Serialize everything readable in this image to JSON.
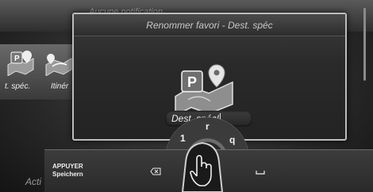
{
  "background": {
    "notification_text": "Aucune notification",
    "favorites": [
      {
        "label": "t. spéc.",
        "icon": "parking-map-icon"
      },
      {
        "label": "Itinér",
        "icon": "route-map-icon"
      }
    ],
    "bottom_left_text": "Acti"
  },
  "dialog": {
    "title": "Renommer favori - Dest. spéc",
    "icon": "parking-map-icon",
    "name_value": "Dest. spéc!"
  },
  "speller": {
    "chars": [
      "1",
      "r",
      "q"
    ]
  },
  "bottom_bar": {
    "action_line1": "APPUYER",
    "action_line2": "Speichern",
    "backspace_icon": "backspace-icon",
    "space_icon": "space-icon",
    "touch_icon": "touch-finger-icon"
  },
  "colors": {
    "frame": "#bdbdbd",
    "background": "#1c1c1c"
  }
}
